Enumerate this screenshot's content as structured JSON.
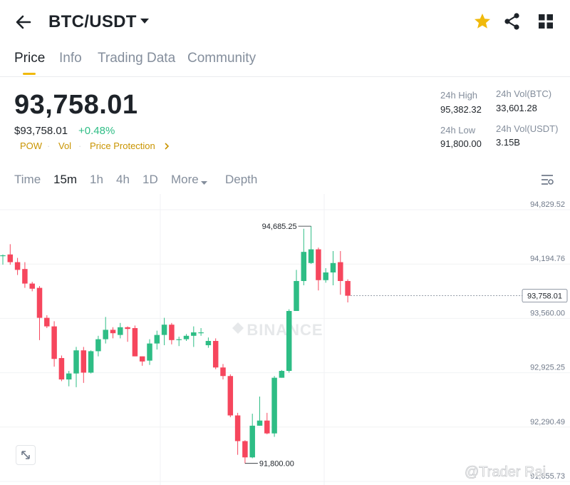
{
  "header": {
    "pair": "BTC/USDT",
    "icons": [
      "back-arrow-icon",
      "caret-down-icon",
      "star-icon",
      "share-icon",
      "grid-icon"
    ],
    "star_color": "#f0b90b"
  },
  "tabs": [
    {
      "label": "Price",
      "active": true
    },
    {
      "label": "Info",
      "active": false
    },
    {
      "label": "Trading Data",
      "active": false
    },
    {
      "label": "Community",
      "active": false
    }
  ],
  "price": {
    "last": "93,758.01",
    "usd": "$93,758.01",
    "change": "+0.48%",
    "change_color": "#2ebd85",
    "tags": [
      "POW",
      "Vol",
      "Price Protection"
    ]
  },
  "stats": {
    "high_label": "24h High",
    "high": "95,382.32",
    "low_label": "24h Low",
    "low": "91,800.00",
    "vol_btc_label": "24h Vol(BTC)",
    "vol_btc": "33,601.28",
    "vol_usdt_label": "24h Vol(USDT)",
    "vol_usdt": "3.15B"
  },
  "timeframes": [
    {
      "label": "Time",
      "active": false
    },
    {
      "label": "15m",
      "active": true
    },
    {
      "label": "1h",
      "active": false
    },
    {
      "label": "4h",
      "active": false
    },
    {
      "label": "1D",
      "active": false
    },
    {
      "label": "More",
      "active": false
    },
    {
      "label": "Depth",
      "active": false
    }
  ],
  "chart_data": {
    "type": "candlestick",
    "interval": "15m",
    "y_ticks": [
      "94,829.52",
      "94,194.76",
      "93,560.00",
      "92,925.25",
      "92,290.49",
      "91,655.73"
    ],
    "ylim": [
      91655.73,
      94829.52
    ],
    "current_price": 93758.01,
    "current_price_label": "93,758.01",
    "high_annotation": "94,685.25",
    "low_annotation": "91,800.00",
    "watermark": "BINANCE",
    "up_color": "#2ebd85",
    "down_color": "#f6465d",
    "candles": [
      {
        "o": 94220,
        "h": 94240,
        "l": 94120,
        "c": 94230
      },
      {
        "o": 94240,
        "h": 94360,
        "l": 94120,
        "c": 94150
      },
      {
        "o": 94150,
        "h": 94200,
        "l": 94000,
        "c": 94060
      },
      {
        "o": 94070,
        "h": 94150,
        "l": 93850,
        "c": 93900
      },
      {
        "o": 93900,
        "h": 93920,
        "l": 93810,
        "c": 93840
      },
      {
        "o": 93850,
        "h": 93870,
        "l": 93240,
        "c": 93500
      },
      {
        "o": 93500,
        "h": 93530,
        "l": 93380,
        "c": 93400
      },
      {
        "o": 93400,
        "h": 93460,
        "l": 92930,
        "c": 93020
      },
      {
        "o": 93030,
        "h": 93060,
        "l": 92760,
        "c": 92780
      },
      {
        "o": 92780,
        "h": 92880,
        "l": 92700,
        "c": 92850
      },
      {
        "o": 92850,
        "h": 93160,
        "l": 92690,
        "c": 93120
      },
      {
        "o": 93120,
        "h": 93160,
        "l": 92740,
        "c": 92860
      },
      {
        "o": 92860,
        "h": 93120,
        "l": 92850,
        "c": 93110
      },
      {
        "o": 93110,
        "h": 93290,
        "l": 93050,
        "c": 93250
      },
      {
        "o": 93250,
        "h": 93510,
        "l": 93200,
        "c": 93360
      },
      {
        "o": 93360,
        "h": 93390,
        "l": 93260,
        "c": 93320
      },
      {
        "o": 93300,
        "h": 93440,
        "l": 93260,
        "c": 93390
      },
      {
        "o": 93390,
        "h": 93400,
        "l": 93220,
        "c": 93370
      },
      {
        "o": 93380,
        "h": 93410,
        "l": 93050,
        "c": 93050
      },
      {
        "o": 93050,
        "h": 93050,
        "l": 92940,
        "c": 92990
      },
      {
        "o": 93000,
        "h": 93250,
        "l": 92950,
        "c": 93200
      },
      {
        "o": 93200,
        "h": 93350,
        "l": 93130,
        "c": 93300
      },
      {
        "o": 93300,
        "h": 93500,
        "l": 93180,
        "c": 93420
      },
      {
        "o": 93420,
        "h": 93440,
        "l": 93190,
        "c": 93240
      },
      {
        "o": 93240,
        "h": 93280,
        "l": 93170,
        "c": 93250
      },
      {
        "o": 93250,
        "h": 93310,
        "l": 93230,
        "c": 93290
      },
      {
        "o": 93290,
        "h": 93400,
        "l": 93160,
        "c": 93330
      },
      {
        "o": 93330,
        "h": 93380,
        "l": 93290,
        "c": 93330
      },
      {
        "o": 93180,
        "h": 93270,
        "l": 93150,
        "c": 93230
      },
      {
        "o": 93230,
        "h": 93260,
        "l": 92900,
        "c": 92920
      },
      {
        "o": 92920,
        "h": 92960,
        "l": 92780,
        "c": 92820
      },
      {
        "o": 92820,
        "h": 92840,
        "l": 92340,
        "c": 92360
      },
      {
        "o": 92360,
        "h": 92390,
        "l": 91900,
        "c": 92060
      },
      {
        "o": 92060,
        "h": 92070,
        "l": 91800,
        "c": 91870
      },
      {
        "o": 91870,
        "h": 92380,
        "l": 91860,
        "c": 92240
      },
      {
        "o": 92240,
        "h": 92580,
        "l": 92240,
        "c": 92300
      },
      {
        "o": 92300,
        "h": 92390,
        "l": 92140,
        "c": 92150
      },
      {
        "o": 92150,
        "h": 92820,
        "l": 92110,
        "c": 92800
      },
      {
        "o": 92800,
        "h": 92890,
        "l": 92800,
        "c": 92880
      },
      {
        "o": 92880,
        "h": 93600,
        "l": 92860,
        "c": 93580
      },
      {
        "o": 93580,
        "h": 94060,
        "l": 93580,
        "c": 93930
      },
      {
        "o": 93930,
        "h": 94540,
        "l": 93880,
        "c": 94270
      },
      {
        "o": 94140,
        "h": 94570,
        "l": 94130,
        "c": 94300
      },
      {
        "o": 94300,
        "h": 94320,
        "l": 93820,
        "c": 93940
      },
      {
        "o": 93940,
        "h": 94080,
        "l": 93910,
        "c": 94030
      },
      {
        "o": 94030,
        "h": 94280,
        "l": 93880,
        "c": 94140
      },
      {
        "o": 94150,
        "h": 94280,
        "l": 93770,
        "c": 93930
      },
      {
        "o": 93930,
        "h": 93950,
        "l": 93680,
        "c": 93758.01
      }
    ]
  },
  "credit": "@Trader Rai"
}
